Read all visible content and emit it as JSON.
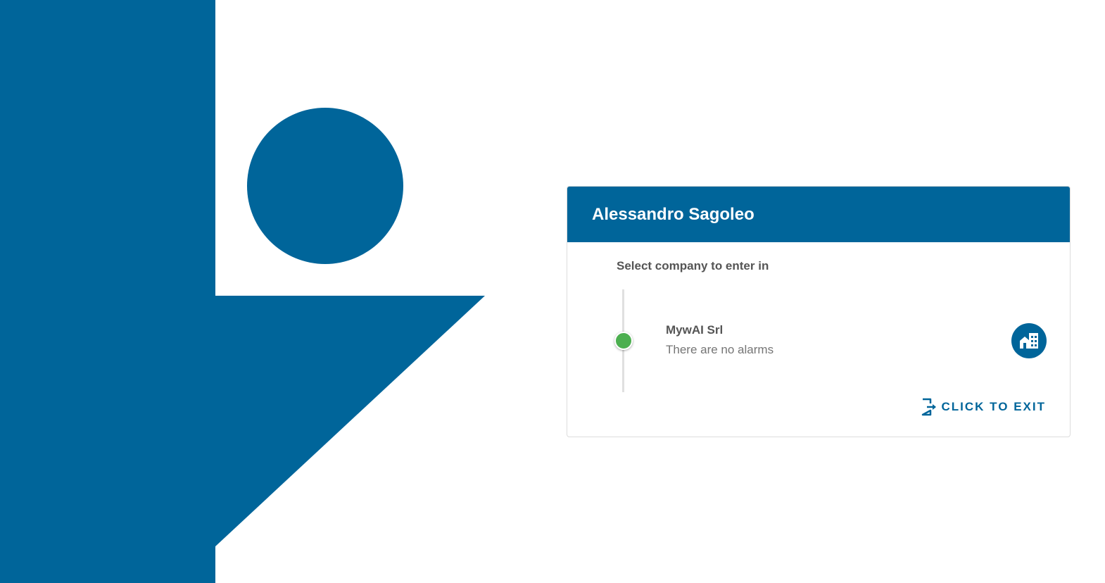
{
  "user": {
    "name": "Alessandro Sagoleo"
  },
  "card": {
    "subtitle": "Select company to enter in",
    "exit_label": "CLICK TO EXIT"
  },
  "companies": [
    {
      "name": "MywAI Srl",
      "status": "There are no alarms",
      "status_color": "#4caf50",
      "icon": "building-icon"
    }
  ],
  "colors": {
    "brand": "#00659a",
    "status_ok": "#4caf50"
  }
}
